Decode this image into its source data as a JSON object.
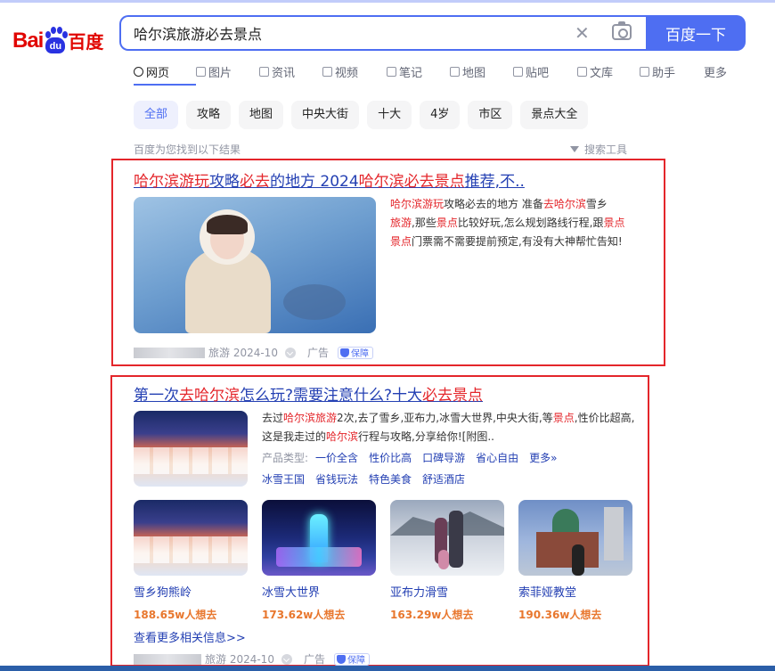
{
  "logo": {
    "part1": "Bai",
    "part2": "du",
    "part3": "百度"
  },
  "search": {
    "query": "哈尔滨旅游必去景点",
    "clear_glyph": "✕",
    "button": "百度一下"
  },
  "tabs": [
    {
      "label": "网页",
      "icon": "search-icon",
      "active": true
    },
    {
      "label": "图片",
      "icon": "image-icon"
    },
    {
      "label": "资讯",
      "icon": "news-icon"
    },
    {
      "label": "视频",
      "icon": "video-icon"
    },
    {
      "label": "笔记",
      "icon": "note-icon"
    },
    {
      "label": "地图",
      "icon": "map-icon"
    },
    {
      "label": "贴吧",
      "icon": "tieba-icon"
    },
    {
      "label": "文库",
      "icon": "doc-icon"
    },
    {
      "label": "助手",
      "icon": "ai-icon"
    },
    {
      "label": "更多"
    }
  ],
  "filters": [
    "全部",
    "攻略",
    "地图",
    "中央大街",
    "十大",
    "4岁",
    "市区",
    "景点大全"
  ],
  "found_text": "百度为您找到以下结果",
  "tools_text": "搜索工具",
  "result1": {
    "title": {
      "a": "哈尔滨游玩",
      "b": "攻略",
      "c": "必去",
      "d": "的地方 2024",
      "e": "哈尔滨必去景点",
      "f": "推荐,不.."
    },
    "desc": {
      "a": "哈尔滨游玩",
      "b": "攻略必去的地方 准备",
      "c": "去哈尔滨",
      "d": "雪乡",
      "e": "旅游",
      "f": ",那些",
      "g": "景点",
      "h": "比较好玩,怎么规划路线行程,跟",
      "i": "景点",
      "j": "门票需不需要提前预定,有没有大神帮忙告知!"
    },
    "meta": {
      "source": "旅游 2024-10",
      "ad": "广告",
      "badge": "保障"
    }
  },
  "result2": {
    "title": {
      "a": "第一次",
      "b": "去哈尔滨",
      "c": "怎么玩?需要注意什么?十大",
      "d": "必去景点"
    },
    "desc": {
      "a": "去过",
      "b": "哈尔滨旅游",
      "c": "2次,去了雪乡,亚布力,冰雪大世界,中央大街,等",
      "d": "景点",
      "e": ",性价比超高,这是我走过的",
      "f": "哈尔滨",
      "g": "行程与攻略,分享给你![附图.."
    },
    "product_label": "产品类型:",
    "product_links": [
      "一价全含",
      "性价比高",
      "口碑导游",
      "省心自由",
      "更多»"
    ],
    "product_links2": [
      "冰雪王国",
      "省钱玩法",
      "特色美食",
      "舒适酒店"
    ],
    "cards": [
      {
        "name": "雪乡狗熊岭",
        "count": "188.65w人想去"
      },
      {
        "name": "冰雪大世界",
        "count": "173.62w人想去"
      },
      {
        "name": "亚布力滑雪",
        "count": "163.29w人想去"
      },
      {
        "name": "索菲娅教堂",
        "count": "190.36w人想去"
      }
    ],
    "more": "查看更多相关信息>>",
    "meta": {
      "source": "旅游 2024-10",
      "ad": "广告",
      "badge": "保障"
    }
  },
  "colors": {
    "accent": "#4e6ef2",
    "highlight": "#e4262b",
    "link": "#2440b3",
    "count": "#e8772e",
    "annotation_box": "#e4262b"
  }
}
